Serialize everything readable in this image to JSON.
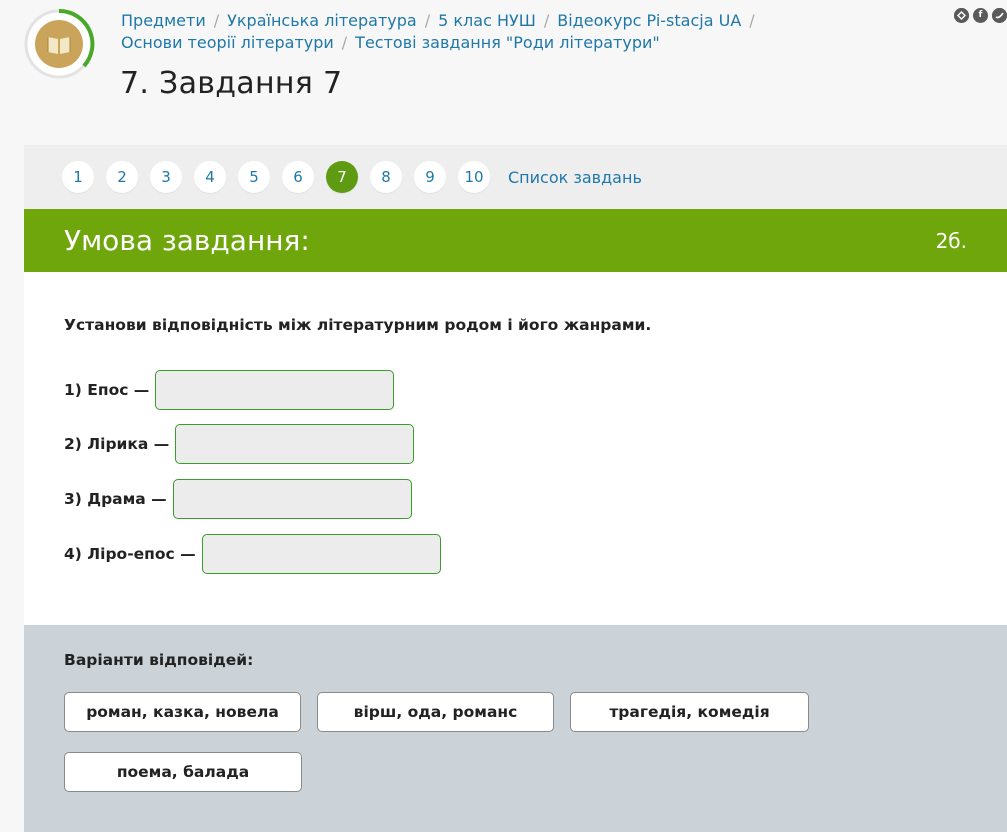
{
  "header": {
    "breadcrumbs": [
      "Предмети",
      "Українська література",
      "5 клас НУШ",
      "Відеокурс Pi-stacja UA",
      "Основи теорії літератури",
      "Тестові завдання \"Роди літератури\""
    ],
    "separator": "/",
    "title": "7. Завдання 7",
    "share_icons": [
      "share-icon",
      "facebook-icon",
      "twitter-icon"
    ]
  },
  "nav": {
    "numbers": [
      "1",
      "2",
      "3",
      "4",
      "5",
      "6",
      "7",
      "8",
      "9",
      "10"
    ],
    "active": "7",
    "list_link": "Список завдань"
  },
  "condition": {
    "title": "Умова завдання:",
    "score": "2б."
  },
  "task": {
    "instruction": "Установи відповідність між літературним родом і його жанрами.",
    "rows": [
      {
        "label": "1) Епос —",
        "value": ""
      },
      {
        "label": "2) Лірика —",
        "value": ""
      },
      {
        "label": "3) Драма —",
        "value": ""
      },
      {
        "label": "4) Ліро-епос —",
        "value": ""
      }
    ]
  },
  "answers": {
    "title": "Варіанти відповідей:",
    "options": [
      "роман, казка, новела",
      "вірш, ода, романс",
      "трагедія, комедія",
      "поема, балада"
    ]
  },
  "colors": {
    "accent_green": "#6ea60b",
    "active_green": "#5e9a12",
    "link_blue": "#1f78a8",
    "drop_border": "#3a9c2a",
    "answers_bg": "#ccd3d8"
  }
}
